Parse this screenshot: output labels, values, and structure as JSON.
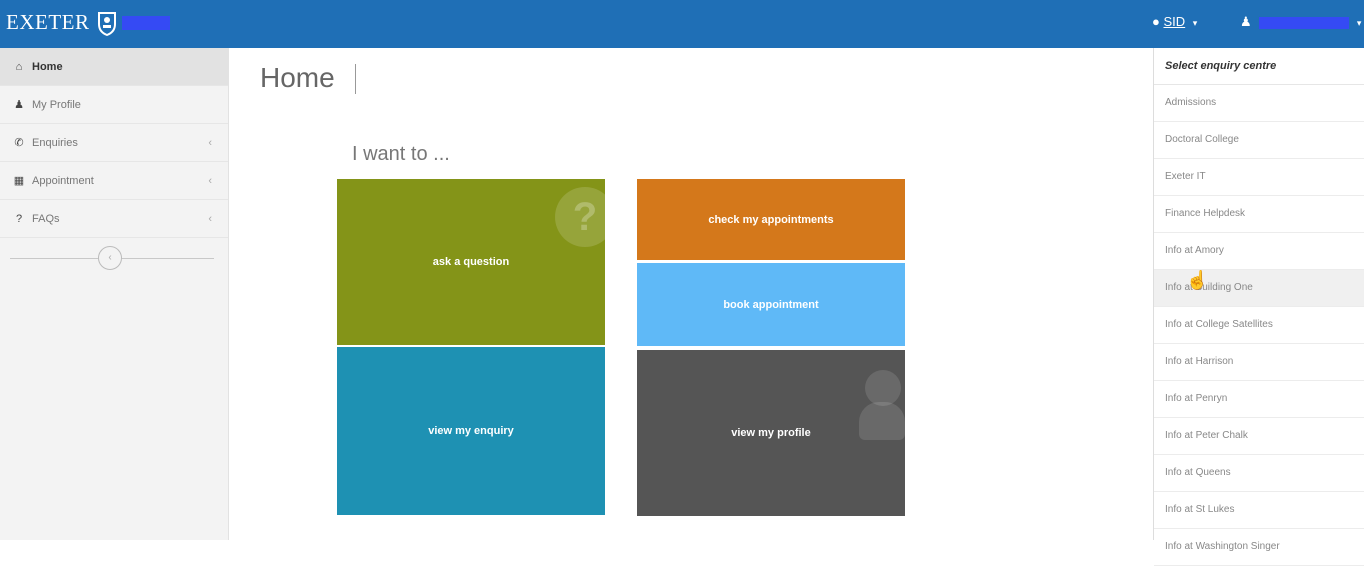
{
  "header": {
    "logo_text": "EXETER",
    "sid_label": "SID",
    "sid_icon": "comments-icon",
    "user_icon": "user-icon"
  },
  "sidebar": {
    "items": [
      {
        "label": "Home",
        "icon": "home-icon",
        "glyph": "⌂",
        "active": true,
        "chevron": false
      },
      {
        "label": "My Profile",
        "icon": "user-icon",
        "glyph": "♟",
        "active": false,
        "chevron": false
      },
      {
        "label": "Enquiries",
        "icon": "phone-icon",
        "glyph": "✆",
        "active": false,
        "chevron": true
      },
      {
        "label": "Appointment",
        "icon": "calendar-icon",
        "glyph": "▦",
        "active": false,
        "chevron": true
      },
      {
        "label": "FAQs",
        "icon": "question-icon",
        "glyph": "?",
        "active": false,
        "chevron": true
      }
    ],
    "chevron_glyph": "‹",
    "collapse_glyph": "‹"
  },
  "main": {
    "title": "Home",
    "subtitle": "I want to ...",
    "tiles": {
      "ask": "ask a question",
      "check": "check my appointments",
      "book": "book appointment",
      "enquiry": "view my enquiry",
      "profile": "view my profile"
    },
    "ask_icon_glyph": "?"
  },
  "dropdown": {
    "header": "Select enquiry centre",
    "items": [
      "Admissions",
      "Doctoral College",
      "Exeter IT",
      "Finance Helpdesk",
      "Info at Amory",
      "Info at Building One",
      "Info at College Satellites",
      "Info at Harrison",
      "Info at Penryn",
      "Info at Peter Chalk",
      "Info at Queens",
      "Info at St Lukes",
      "Info at Washington Singer"
    ],
    "hovered_index": 5
  },
  "colors": {
    "topbar": "#1f6fb6",
    "ask": "#849418",
    "check": "#d4781b",
    "book": "#5fb9f7",
    "enquiry": "#1e91b3",
    "profile": "#555555"
  }
}
